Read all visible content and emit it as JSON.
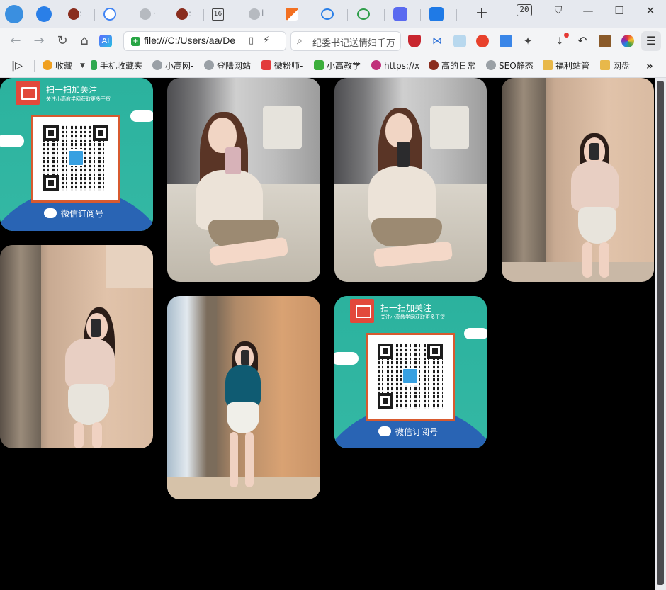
{
  "browser": {
    "tab_count": "20",
    "address_url": "file:///C:/Users/aa/De",
    "search_placeholder": "纪委书记送情妇千万",
    "window_controls": {
      "minimize": "—",
      "maximize": "☐",
      "close": "✕"
    },
    "new_tab_label": "+"
  },
  "bookmarks": [
    {
      "label": "收藏",
      "icon": "star-icon",
      "color": "#f0a020"
    },
    {
      "label": "手机收藏夹",
      "icon": "phone-icon",
      "color": "#2fa84f"
    },
    {
      "label": "小高网-",
      "icon": "globe-icon",
      "color": "#9aa0a6"
    },
    {
      "label": "登陆网站",
      "icon": "globe-icon",
      "color": "#9aa0a6"
    },
    {
      "label": "微粉师-",
      "icon": "coupon-icon",
      "color": "#e23b3b"
    },
    {
      "label": "小高教学",
      "icon": "check-icon",
      "color": "#3cae3c"
    },
    {
      "label": "https://x",
      "icon": "spiral-icon",
      "color": "#c0307a"
    },
    {
      "label": "高的日常",
      "icon": "avatar-icon",
      "color": "#8a2d1e"
    },
    {
      "label": "SEO静态",
      "icon": "globe-icon",
      "color": "#9aa0a6"
    },
    {
      "label": "福利站管",
      "icon": "folder-icon",
      "color": "#e8b84a"
    },
    {
      "label": "网盘",
      "icon": "folder-icon",
      "color": "#e8b84a"
    }
  ],
  "qr_card": {
    "title": "扫一扫加关注",
    "subtitle": "关注小高教学网获取更多干货",
    "footer": "微信订阅号",
    "colors": {
      "teal": "#2eae9b",
      "blue": "#2964b4",
      "frame": "#d85a2f"
    }
  },
  "gallery": [
    {
      "kind": "qr",
      "alt": "wechat-qr-card"
    },
    {
      "kind": "photo",
      "alt": "woman-in-armchair-1"
    },
    {
      "kind": "photo",
      "alt": "woman-in-armchair-2"
    },
    {
      "kind": "photo",
      "alt": "woman-mirror-beige-1"
    },
    {
      "kind": "photo",
      "alt": "woman-mirror-beige-2"
    },
    {
      "kind": "photo",
      "alt": "woman-mirror-teal"
    },
    {
      "kind": "qr",
      "alt": "wechat-qr-card"
    }
  ]
}
